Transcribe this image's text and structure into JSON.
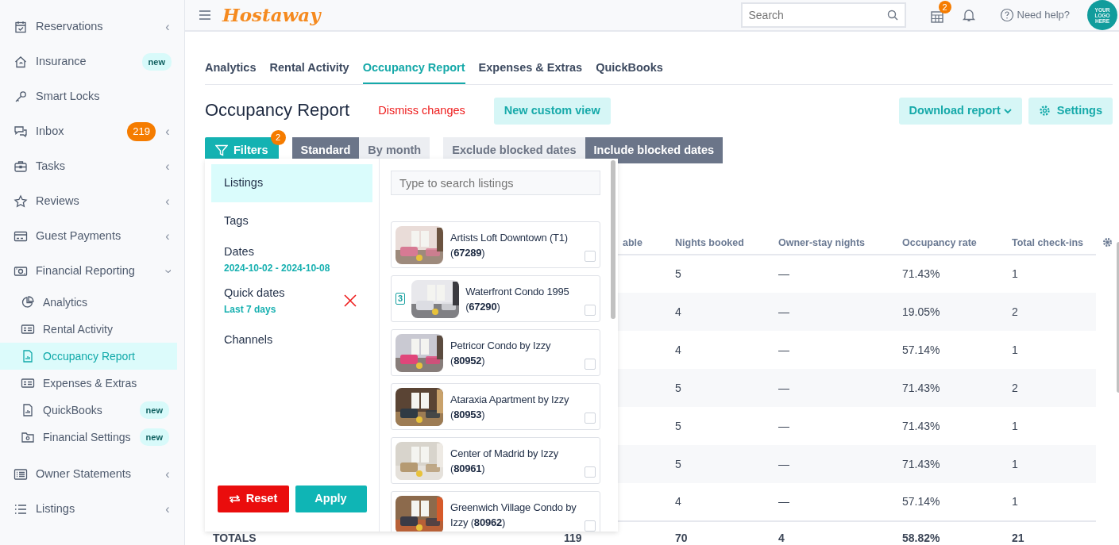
{
  "sidebar": {
    "items": [
      {
        "label": "Reservations",
        "chevron": "‹",
        "expanded": false
      },
      {
        "label": "Insurance",
        "tag": "new"
      },
      {
        "label": "Smart Locks"
      },
      {
        "label": "Inbox",
        "count": "219",
        "chevron": "‹",
        "expanded": false
      },
      {
        "label": "Tasks",
        "chevron": "‹",
        "expanded": false
      },
      {
        "label": "Reviews",
        "chevron": "‹",
        "expanded": false
      },
      {
        "label": "Guest Payments",
        "chevron": "‹",
        "expanded": false
      },
      {
        "label": "Financial Reporting",
        "chevron": "‹",
        "expanded": true,
        "children": [
          {
            "label": "Analytics",
            "selected": false
          },
          {
            "label": "Rental Activity",
            "selected": false
          },
          {
            "label": "Occupancy Report",
            "selected": true
          },
          {
            "label": "Expenses & Extras",
            "selected": false
          },
          {
            "label": "QuickBooks",
            "selected": false,
            "tag": "new"
          },
          {
            "label": "Financial Settings",
            "selected": false,
            "tag": "new"
          }
        ]
      },
      {
        "label": "Owner Statements",
        "chevron": "‹",
        "expanded": false
      },
      {
        "label": "Listings",
        "chevron": "‹",
        "expanded": false
      }
    ]
  },
  "topbar": {
    "logo": "Hostaway",
    "search": {
      "placeholder": "Search"
    },
    "calendar_badge": "2",
    "help": "Need help?",
    "avatar": "YOUR LOGO HERE"
  },
  "tabs": [
    {
      "label": "Analytics",
      "selected": false
    },
    {
      "label": "Rental Activity",
      "selected": false
    },
    {
      "label": "Occupancy Report",
      "selected": true
    },
    {
      "label": "Expenses & Extras",
      "selected": false
    },
    {
      "label": "QuickBooks",
      "selected": false
    }
  ],
  "title": "Occupancy Report",
  "dismiss": "Dismiss changes",
  "new_view": "New custom view",
  "download": "Download report",
  "settings": "Settings",
  "filters": {
    "label": "Filters",
    "count": "2"
  },
  "view_toggle": [
    {
      "label": "Standard",
      "selected": true
    },
    {
      "label": "By month",
      "selected": false
    }
  ],
  "blocked_toggle": [
    {
      "label": "Exclude blocked dates",
      "selected": false
    },
    {
      "label": "Include blocked dates",
      "selected": true
    }
  ],
  "filter_panel": {
    "categories": [
      {
        "label": "Listings",
        "selected": true
      },
      {
        "label": "Tags",
        "selected": false
      },
      {
        "label": "Dates",
        "selected": false,
        "value": "2024-10-02 - 2024-10-08"
      },
      {
        "label": "Quick dates",
        "selected": false,
        "value": "Last 7 days",
        "clearable": true
      },
      {
        "label": "Channels",
        "selected": false
      }
    ],
    "reset": "Reset",
    "apply": "Apply",
    "search": {
      "placeholder": "Type to search listings"
    },
    "listings": [
      {
        "name": "Artists Loft Downtown (T1)  (**67289**)",
        "checked": false
      },
      {
        "name": "Waterfront Condo 1995  (**67290**)",
        "checked": false,
        "group_count": "3"
      },
      {
        "name": "Petricor Condo by Izzy (**80952**)",
        "checked": false
      },
      {
        "name": "Ataraxia Apartment by Izzy  (**80953**)",
        "checked": false
      },
      {
        "name": "Center of Madrid by Izzy  (**80961**)",
        "checked": false
      },
      {
        "name": "Greenwich Village Condo by Izzy  (**80962**)",
        "checked": false
      }
    ]
  },
  "table": {
    "columns": [
      "able",
      "Nights booked",
      "Owner-stay nights",
      "Occupancy rate",
      "Total check-ins"
    ],
    "rows": [
      [
        "",
        "5",
        "—",
        "71.43%",
        "1"
      ],
      [
        "",
        "4",
        "—",
        "19.05%",
        "2"
      ],
      [
        "",
        "4",
        "—",
        "57.14%",
        "1"
      ],
      [
        "",
        "5",
        "—",
        "71.43%",
        "2"
      ],
      [
        "",
        "5",
        "—",
        "71.43%",
        "1"
      ],
      [
        "",
        "5",
        "—",
        "71.43%",
        "1"
      ],
      [
        "",
        "4",
        "—",
        "57.14%",
        "1"
      ]
    ],
    "totals": {
      "label": "TOTALS",
      "values": [
        "119",
        "70",
        "4",
        "58.82%",
        "21"
      ]
    }
  }
}
